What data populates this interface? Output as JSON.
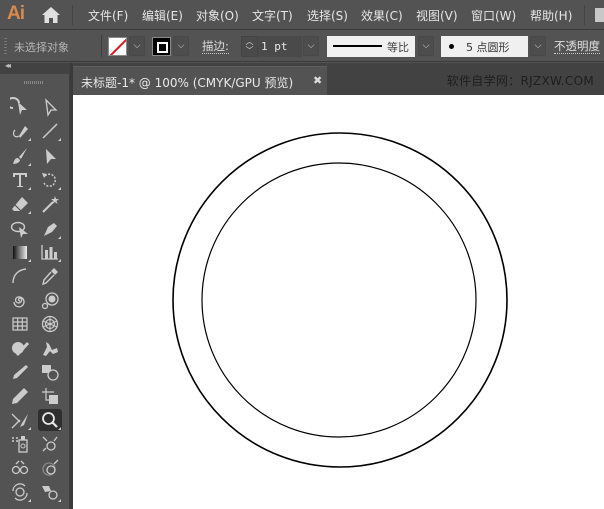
{
  "app": {
    "logo": "Ai"
  },
  "menu": {
    "items": [
      "文件(F)",
      "编辑(E)",
      "对象(O)",
      "文字(T)",
      "选择(S)",
      "效果(C)",
      "视图(V)",
      "窗口(W)",
      "帮助(H)"
    ]
  },
  "control": {
    "selection_status": "未选择对象",
    "stroke_label": "描边",
    "stroke_colon": ":",
    "stroke_weight": "1 pt",
    "variable_profile_label": "等比",
    "brush_size": "5",
    "brush_label": "点圆形",
    "opacity_label": "不透明度",
    "fill_color": "#ffffff",
    "fill_none_slash_color": "#e0161b",
    "stroke_color": "#000000"
  },
  "tools": [
    {
      "name": "selection-tool-icon",
      "col": 0
    },
    {
      "name": "direct-selection-tool-icon",
      "col": 1
    },
    {
      "name": "pen-tool-icon"
    },
    {
      "name": "line-segment-tool-icon"
    },
    {
      "name": "paintbrush-tool-icon"
    },
    {
      "name": "direct-select-arrow-icon"
    },
    {
      "name": "type-tool-icon"
    },
    {
      "name": "rotate-tool-icon"
    },
    {
      "name": "eraser-tool-icon"
    },
    {
      "name": "magic-wand-tool-icon"
    },
    {
      "name": "lasso-tool-icon"
    },
    {
      "name": "anchor-pen-tool-icon"
    },
    {
      "name": "gradient-tool-icon"
    },
    {
      "name": "column-graph-tool-icon"
    },
    {
      "name": "arc-tool-icon"
    },
    {
      "name": "eyedropper-tool-icon"
    },
    {
      "name": "spiral-tool-icon"
    },
    {
      "name": "symbol-sprayer-tool-icon"
    },
    {
      "name": "rectangular-grid-tool-icon"
    },
    {
      "name": "polar-grid-tool-icon"
    },
    {
      "name": "shaper-tool-icon"
    },
    {
      "name": "puppet-warp-tool-icon"
    },
    {
      "name": "blob-brush-tool-icon"
    },
    {
      "name": "shape-builder-tool-icon"
    },
    {
      "name": "pencil-tool-icon"
    },
    {
      "name": "artboard-tool-icon"
    },
    {
      "name": "scissors-tool-icon"
    },
    {
      "name": "zoom-tool-icon",
      "active": true
    },
    {
      "name": "perspective-grid-tool-icon"
    },
    {
      "name": "symbol-shifter-tool-icon"
    },
    {
      "name": "symbol-scruncher-tool-icon"
    },
    {
      "name": "symbol-sizer-tool-icon"
    },
    {
      "name": "symbol-spinner-tool-icon"
    },
    {
      "name": "symbol-stainer-tool-icon"
    }
  ],
  "document": {
    "tab_title": "未标题-1* @ 100% (CMYK/GPU 预览)",
    "close_glyph": "✖",
    "watermark": "软件自学网：RJZXW.COM"
  },
  "artwork": {
    "description": "two concentric circles, black stroke, no fill",
    "stroke_color": "#000000",
    "background": "#ffffff"
  }
}
